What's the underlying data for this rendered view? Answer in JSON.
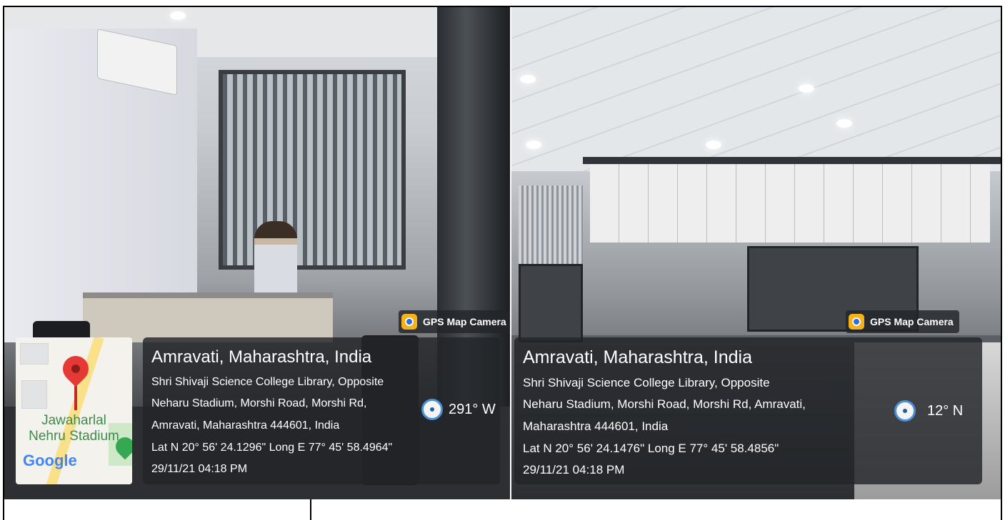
{
  "left_photo": {
    "map": {
      "label_line1": "Jawaharlal",
      "label_line2": "Nehru Stadium",
      "logo_text": "Google"
    },
    "badge": "GPS Map Camera",
    "title": "Amravati, Maharashtra, India",
    "address_lines": [
      "Shri Shivaji Science College Library, Opposite",
      "Neharu Stadium, Morshi Road, Morshi Rd,",
      "Amravati, Maharashtra 444601, India"
    ],
    "coordinates": "Lat N 20° 56' 24.1296\" Long E 77° 45' 58.4964\"",
    "timestamp": "29/11/21 04:18 PM",
    "heading": "291° W"
  },
  "right_photo": {
    "badge": "GPS Map Camera",
    "title": "Amravati, Maharashtra, India",
    "address_lines": [
      "Shri Shivaji Science College Library, Opposite",
      "Neharu Stadium, Morshi Road, Morshi Rd, Amravati,",
      "Maharashtra 444601, India"
    ],
    "coordinates": "Lat N 20° 56' 24.1476\" Long E 77° 45' 58.4856\"",
    "timestamp": "29/11/21 04:18 PM",
    "heading": "12° N"
  },
  "colors": {
    "overlay": "#222428",
    "badge_icon": "#f6b21a",
    "compass_ring": "#4a90d9",
    "map_pin": "#e53935"
  },
  "icons": [
    "gps-map-camera-icon",
    "compass-icon",
    "map-pin-icon",
    "park-icon"
  ]
}
